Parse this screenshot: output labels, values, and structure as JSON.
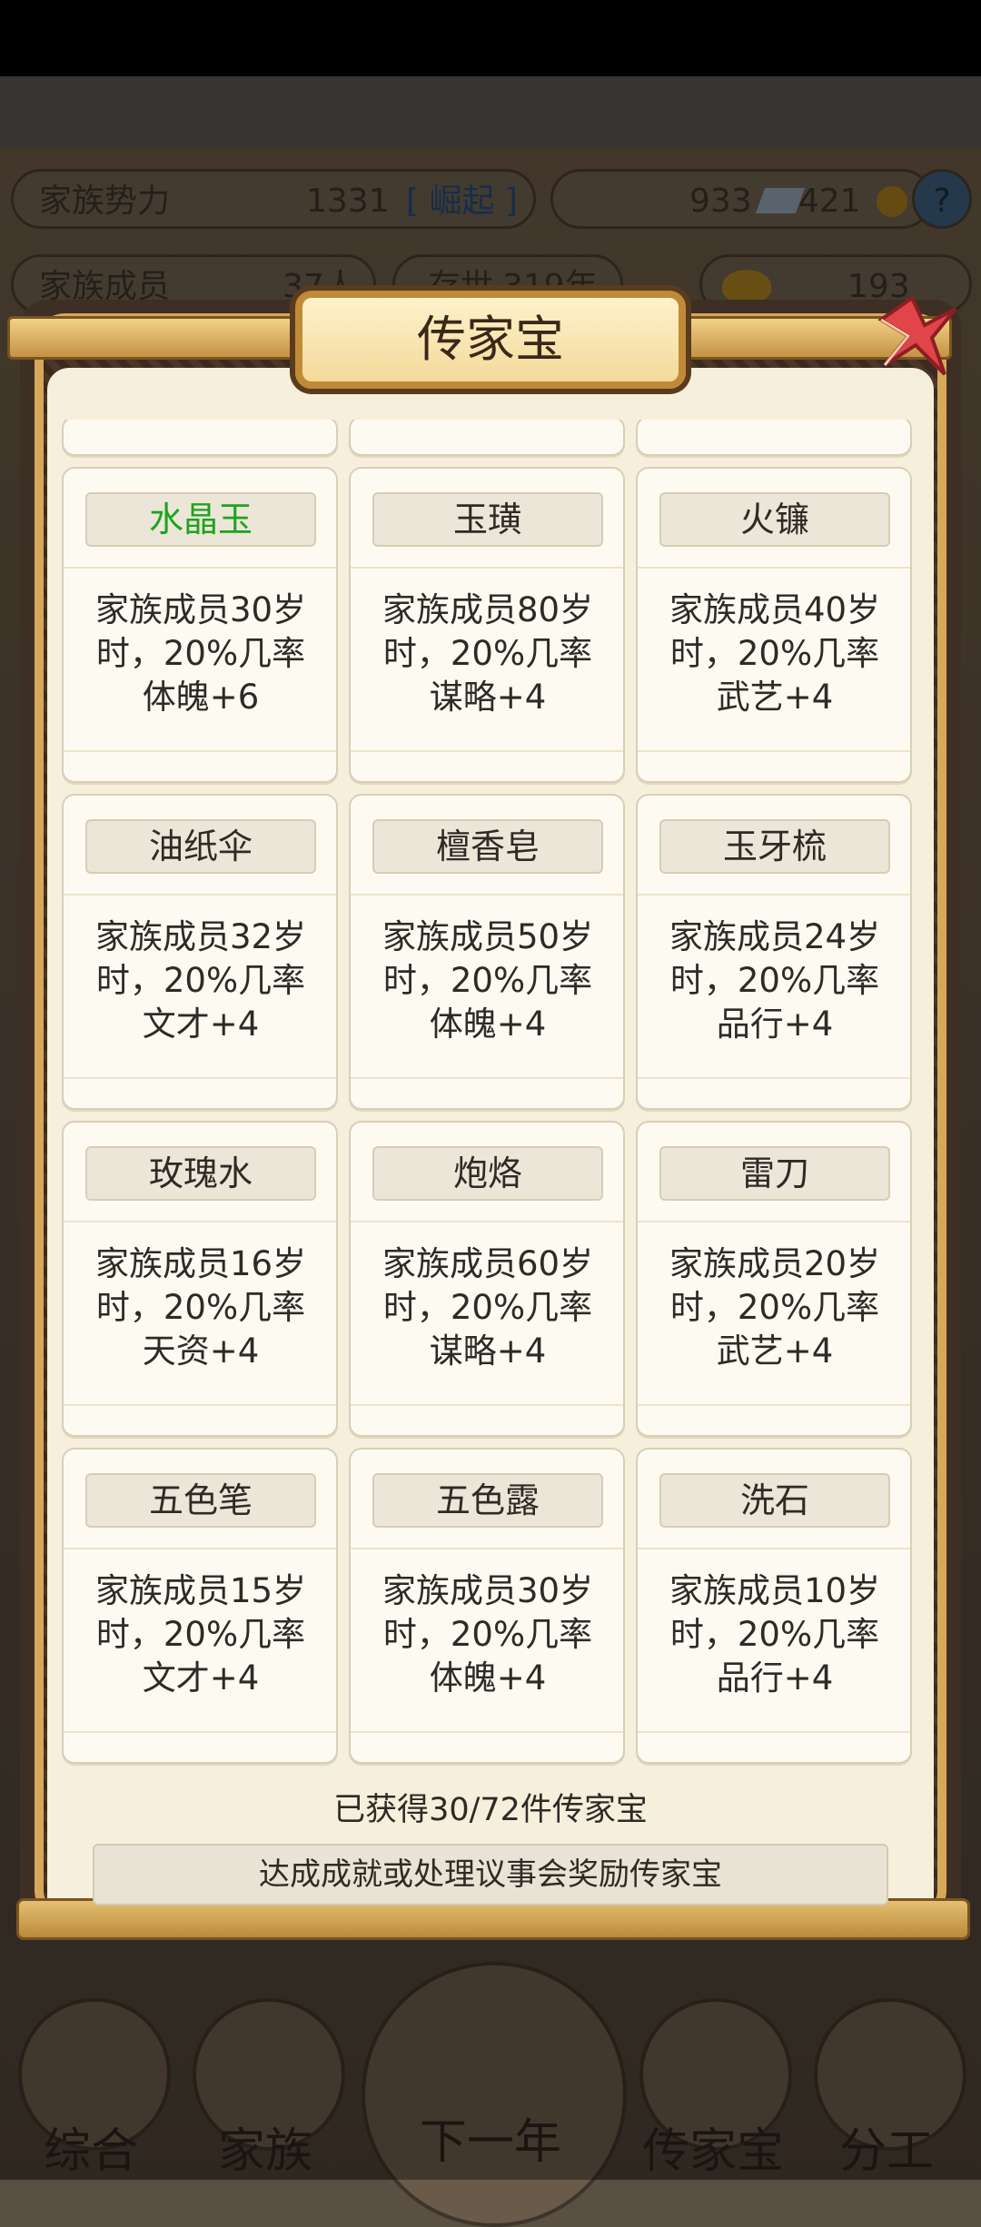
{
  "hud": {
    "power_label": "家族势力",
    "power_value": "1331",
    "power_rank": "[ 崛起 ]",
    "silver": "933",
    "coins": "421",
    "help": "?",
    "members_label": "家族成员",
    "members_value": "37人",
    "age_label": "存世",
    "age_value": "319年",
    "gold": "193"
  },
  "modal": {
    "title": "传家宝",
    "items": [
      {
        "name": "水晶玉",
        "name_color": "#1ea31e",
        "line1": "家族成员30岁",
        "line2": "时，20%几率",
        "line3": "体魄+6"
      },
      {
        "name": "玉璜",
        "name_color": "#2e2a25",
        "line1": "家族成员80岁",
        "line2": "时，20%几率",
        "line3": "谋略+4"
      },
      {
        "name": "火镰",
        "name_color": "#2e2a25",
        "line1": "家族成员40岁",
        "line2": "时，20%几率",
        "line3": "武艺+4"
      },
      {
        "name": "油纸伞",
        "name_color": "#2e2a25",
        "line1": "家族成员32岁",
        "line2": "时，20%几率",
        "line3": "文才+4"
      },
      {
        "name": "檀香皂",
        "name_color": "#2e2a25",
        "line1": "家族成员50岁",
        "line2": "时，20%几率",
        "line3": "体魄+4"
      },
      {
        "name": "玉牙梳",
        "name_color": "#2e2a25",
        "line1": "家族成员24岁",
        "line2": "时，20%几率",
        "line3": "品行+4"
      },
      {
        "name": "玫瑰水",
        "name_color": "#2e2a25",
        "line1": "家族成员16岁",
        "line2": "时，20%几率",
        "line3": "天资+4"
      },
      {
        "name": "炮烙",
        "name_color": "#2e2a25",
        "line1": "家族成员60岁",
        "line2": "时，20%几率",
        "line3": "谋略+4"
      },
      {
        "name": "雷刀",
        "name_color": "#2e2a25",
        "line1": "家族成员20岁",
        "line2": "时，20%几率",
        "line3": "武艺+4"
      },
      {
        "name": "五色笔",
        "name_color": "#2e2a25",
        "line1": "家族成员15岁",
        "line2": "时，20%几率",
        "line3": "文才+4"
      },
      {
        "name": "五色露",
        "name_color": "#2e2a25",
        "line1": "家族成员30岁",
        "line2": "时，20%几率",
        "line3": "体魄+4"
      },
      {
        "name": "洗石",
        "name_color": "#2e2a25",
        "line1": "家族成员10岁",
        "line2": "时，20%几率",
        "line3": "品行+4"
      }
    ],
    "count_text": "已获得30/72件传家宝",
    "hint_text": "达成成就或处理议事会奖励传家宝"
  },
  "nav": {
    "items": [
      "综合",
      "家族",
      "下一年",
      "传家宝",
      "分工"
    ]
  }
}
